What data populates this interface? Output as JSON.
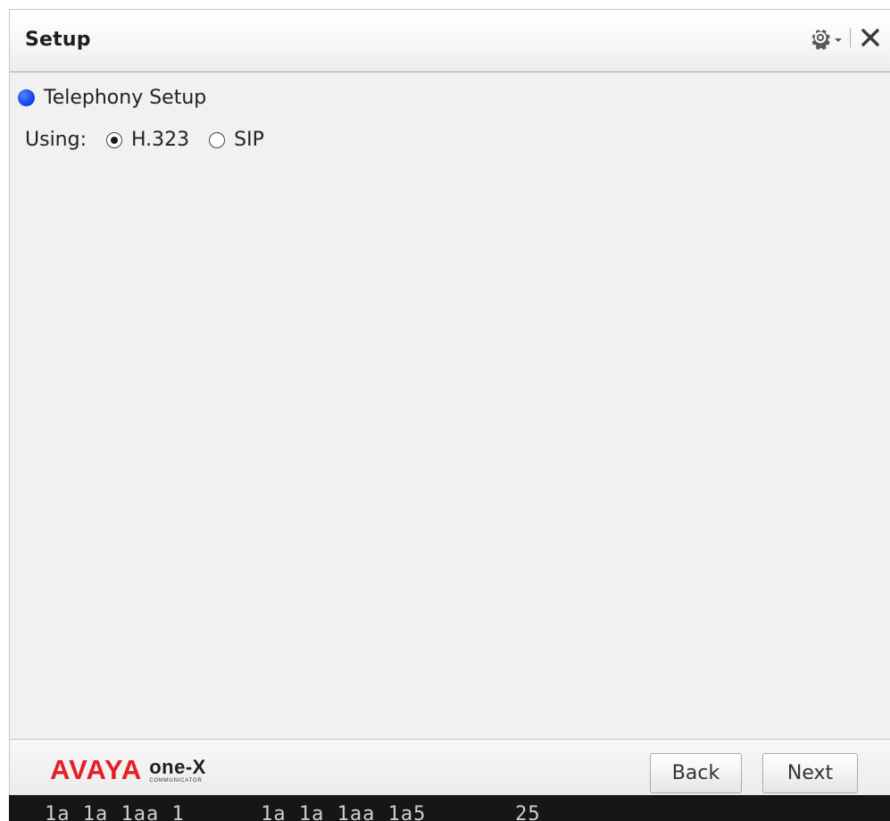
{
  "window": {
    "title": "Setup"
  },
  "toolbar": {
    "settings_icon": "gear-icon",
    "close_icon": "close-icon"
  },
  "section": {
    "label": "Telephony Setup",
    "indicator_color": "#1346e8"
  },
  "protocol": {
    "label": "Using:",
    "options": [
      {
        "label": "H.323",
        "selected": true
      },
      {
        "label": "SIP",
        "selected": false
      }
    ]
  },
  "footer": {
    "logo_brand": "AVAYA",
    "logo_product": "one-X",
    "logo_sub": "COMMUNICATOR",
    "back_label": "Back",
    "next_label": "Next",
    "brand_color": "#e41f26"
  },
  "background_strip": {
    "text": "1a 1a 1aa 1      1a 1a 1aa 1a5       25"
  }
}
